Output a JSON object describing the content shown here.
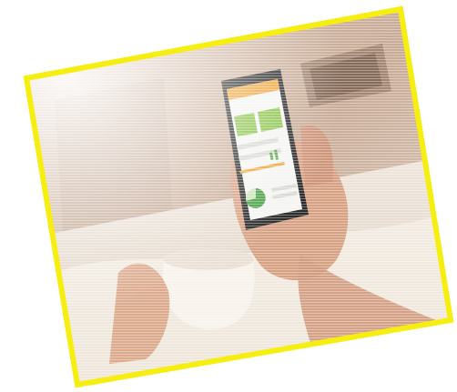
{
  "photo": {
    "subject": "hand-holding-smartphone-with-dashboard-app-and-coffee-cup-in-bed",
    "frame_color": "#f5ee10"
  },
  "phone_screen": {
    "header_color": "#f0a53a",
    "card_color": "#8bc34a",
    "pie_color": "#4aa14a"
  }
}
